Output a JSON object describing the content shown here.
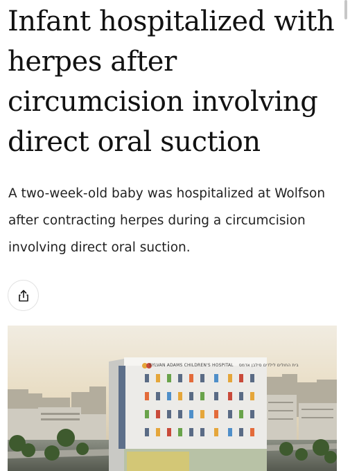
{
  "article": {
    "headline": "Infant hospitalized with herpes after circumcision involving direct oral suction",
    "subtitle": "A two-week-old baby was hospitalized at Wolfson after contracting herpes during a circumcision involving direct oral suction.",
    "share_icon": "share-icon"
  },
  "hero_image": {
    "building_sign_english": "SYLVAN ADAMS CHILDREN'S HOSPITAL",
    "building_sign_hebrew": "בית החולים לילדים סילבן אדמס"
  },
  "colors": {
    "headline": "#111111",
    "body_text": "#222222",
    "share_border": "#e2e2e2",
    "sky": "#e9e0cc",
    "building": "#ececea"
  }
}
